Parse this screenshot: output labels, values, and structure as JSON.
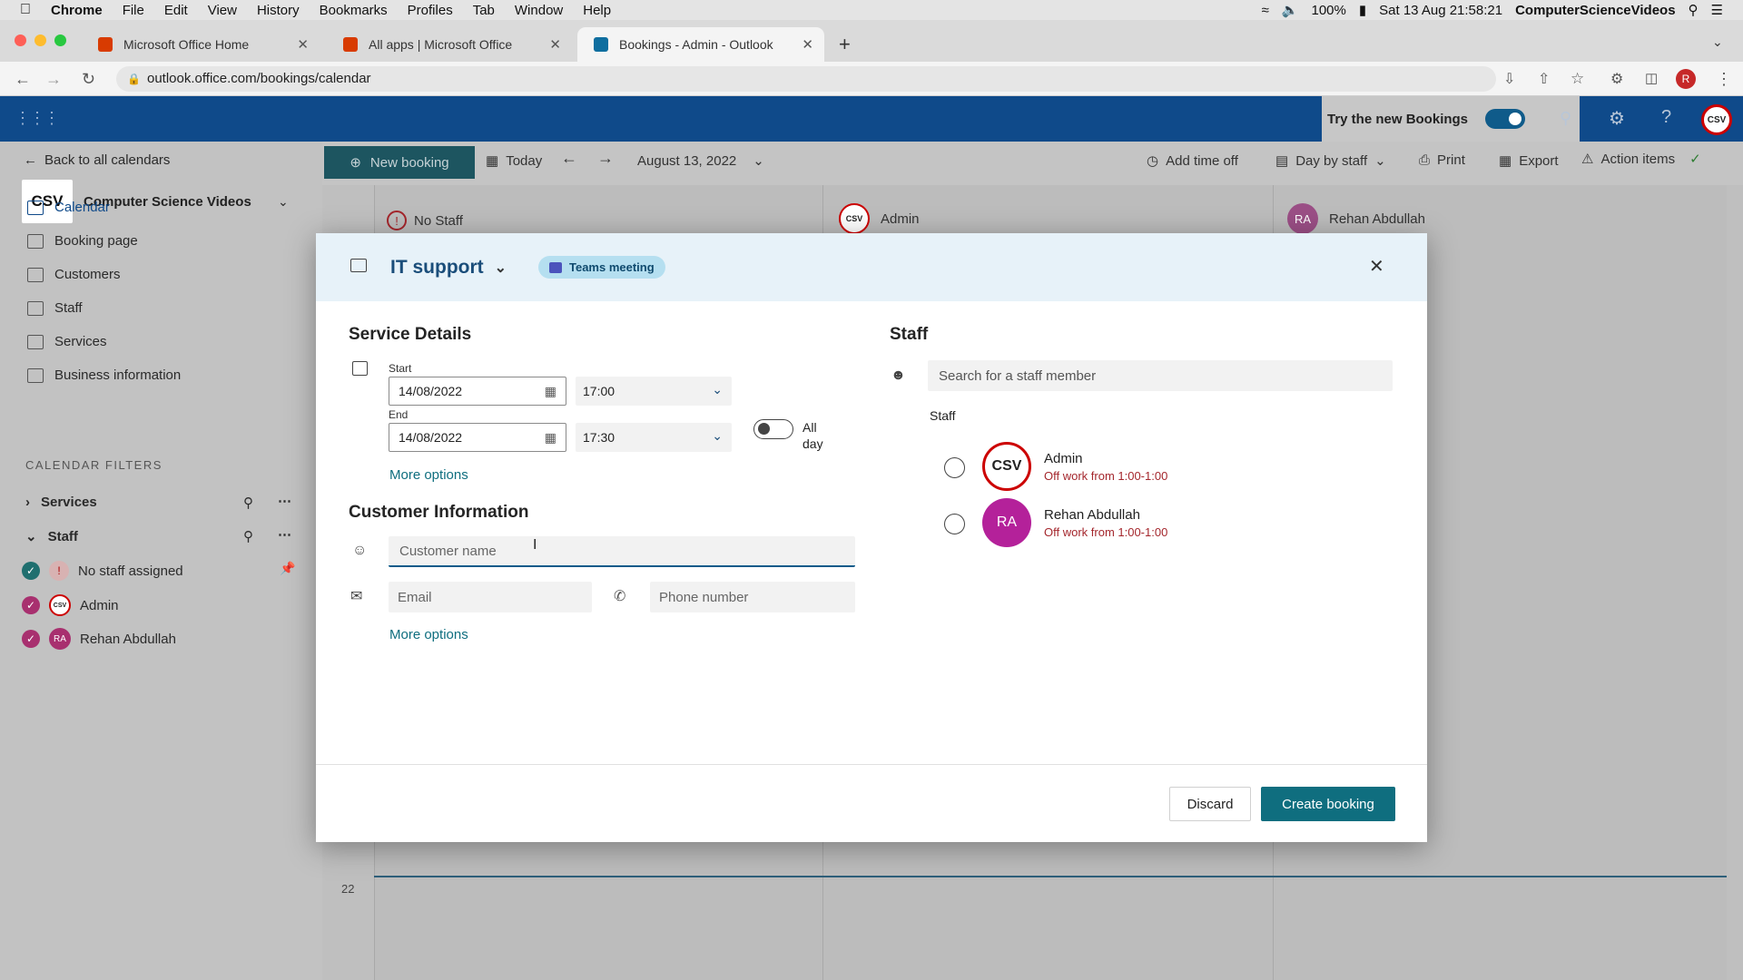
{
  "menubar": {
    "app": "Chrome",
    "items": [
      "File",
      "Edit",
      "View",
      "History",
      "Bookmarks",
      "Profiles",
      "Tab",
      "Window",
      "Help"
    ],
    "battery": "100%",
    "datetime": "Sat 13 Aug  21:58:21",
    "user": "ComputerScienceVideos"
  },
  "tabs": [
    {
      "title": "Microsoft Office Home"
    },
    {
      "title": "All apps | Microsoft Office"
    },
    {
      "title": "Bookings - Admin - Outlook"
    }
  ],
  "address": {
    "url": "outlook.office.com/bookings/calendar"
  },
  "header": {
    "try_new": "Try the new Bookings",
    "profile_initial": "R"
  },
  "sidebar": {
    "back": "Back to all calendars",
    "business_name": "Computer Science Videos",
    "nav": [
      "Calendar",
      "Booking page",
      "Customers",
      "Staff",
      "Services",
      "Business information"
    ],
    "filters_title": "CALENDAR FILTERS",
    "filter_groups": [
      "Services",
      "Staff"
    ],
    "staff_filters": [
      {
        "name": "No staff assigned"
      },
      {
        "name": "Admin"
      },
      {
        "name": "Rehan Abdullah",
        "initials": "RA"
      }
    ]
  },
  "toolbar": {
    "new_booking": "New booking",
    "today": "Today",
    "date": "August 13, 2022",
    "add_time_off": "Add time off",
    "day_by_staff": "Day by staff",
    "print": "Print",
    "export": "Export",
    "action_items": "Action items"
  },
  "calendar": {
    "columns": [
      "No Staff",
      "Admin",
      "Rehan Abdullah"
    ],
    "hour_label": "22"
  },
  "modal": {
    "service": "IT support",
    "badge": "Teams meeting",
    "service_details_title": "Service Details",
    "start_label": "Start",
    "start_date": "14/08/2022",
    "start_time": "17:00",
    "end_label": "End",
    "end_date": "14/08/2022",
    "end_time": "17:30",
    "all_day_line1": "All",
    "all_day_line2": "day",
    "more_options": "More options",
    "customer_title": "Customer Information",
    "customer_name_placeholder": "Customer name",
    "email_placeholder": "Email",
    "phone_placeholder": "Phone number",
    "more_options_2": "More options",
    "staff_title": "Staff",
    "staff_search_placeholder": "Search for a staff member",
    "staff_list_label": "Staff",
    "staff": [
      {
        "name": "Admin",
        "status": "Off work from 1:00-1:00"
      },
      {
        "name": "Rehan Abdullah",
        "initials": "RA",
        "status": "Off work from 1:00-1:00"
      }
    ],
    "discard": "Discard",
    "create": "Create booking"
  },
  "colors": {
    "primary": "#0f6e7f",
    "header_blue": "#0f4a8a",
    "avatar_purple": "#b4219a",
    "off_work_red": "#a4262c"
  }
}
